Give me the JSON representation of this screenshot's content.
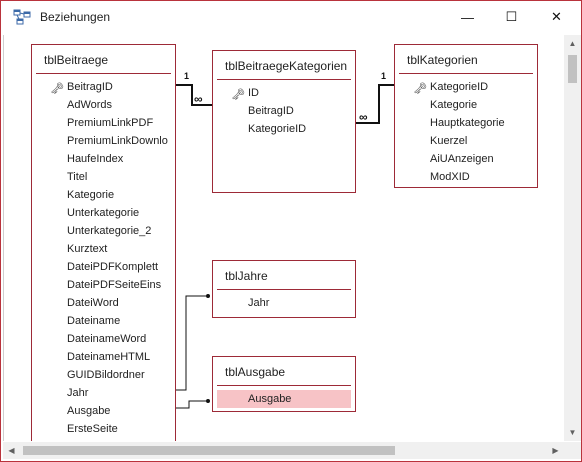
{
  "window": {
    "title": "Beziehungen",
    "controls": {
      "minimize": "—",
      "maximize": "☐",
      "close": "✕"
    }
  },
  "icons": {
    "app": "relationships-icon",
    "primary_key": "key-icon"
  },
  "colors": {
    "border_accent": "#9d2a37",
    "selected_field": "#f7c3c6",
    "window_border": "#b9333c"
  },
  "tables": {
    "tblBeitraege": {
      "name": "tblBeitraege",
      "fields": [
        "BeitragID",
        "AdWords",
        "PremiumLinkPDF",
        "PremiumLinkDownlo",
        "HaufeIndex",
        "Titel",
        "Kategorie",
        "Unterkategorie",
        "Unterkategorie_2",
        "Kurztext",
        "DateiPDFKomplett",
        "DateiPDFSeiteEins",
        "DateiWord",
        "Dateiname",
        "DateinameWord",
        "DateinameHTML",
        "GUIDBildordner",
        "Jahr",
        "Ausgabe",
        "ErsteSeite"
      ]
    },
    "tblBeitraegeKategorien": {
      "name": "tblBeitraegeKategorien",
      "fields": [
        "ID",
        "BeitragID",
        "KategorieID"
      ]
    },
    "tblKategorien": {
      "name": "tblKategorien",
      "fields": [
        "KategorieID",
        "Kategorie",
        "Hauptkategorie",
        "Kuerzel",
        "AiUAnzeigen",
        "ModXID"
      ]
    },
    "tblJahre": {
      "name": "tblJahre",
      "fields": [
        "Jahr"
      ]
    },
    "tblAusgabe": {
      "name": "tblAusgabe",
      "fields": [
        "Ausgabe"
      ],
      "selected_field": "Ausgabe"
    }
  },
  "relationships": {
    "one_label": "1",
    "many_label": "∞"
  }
}
